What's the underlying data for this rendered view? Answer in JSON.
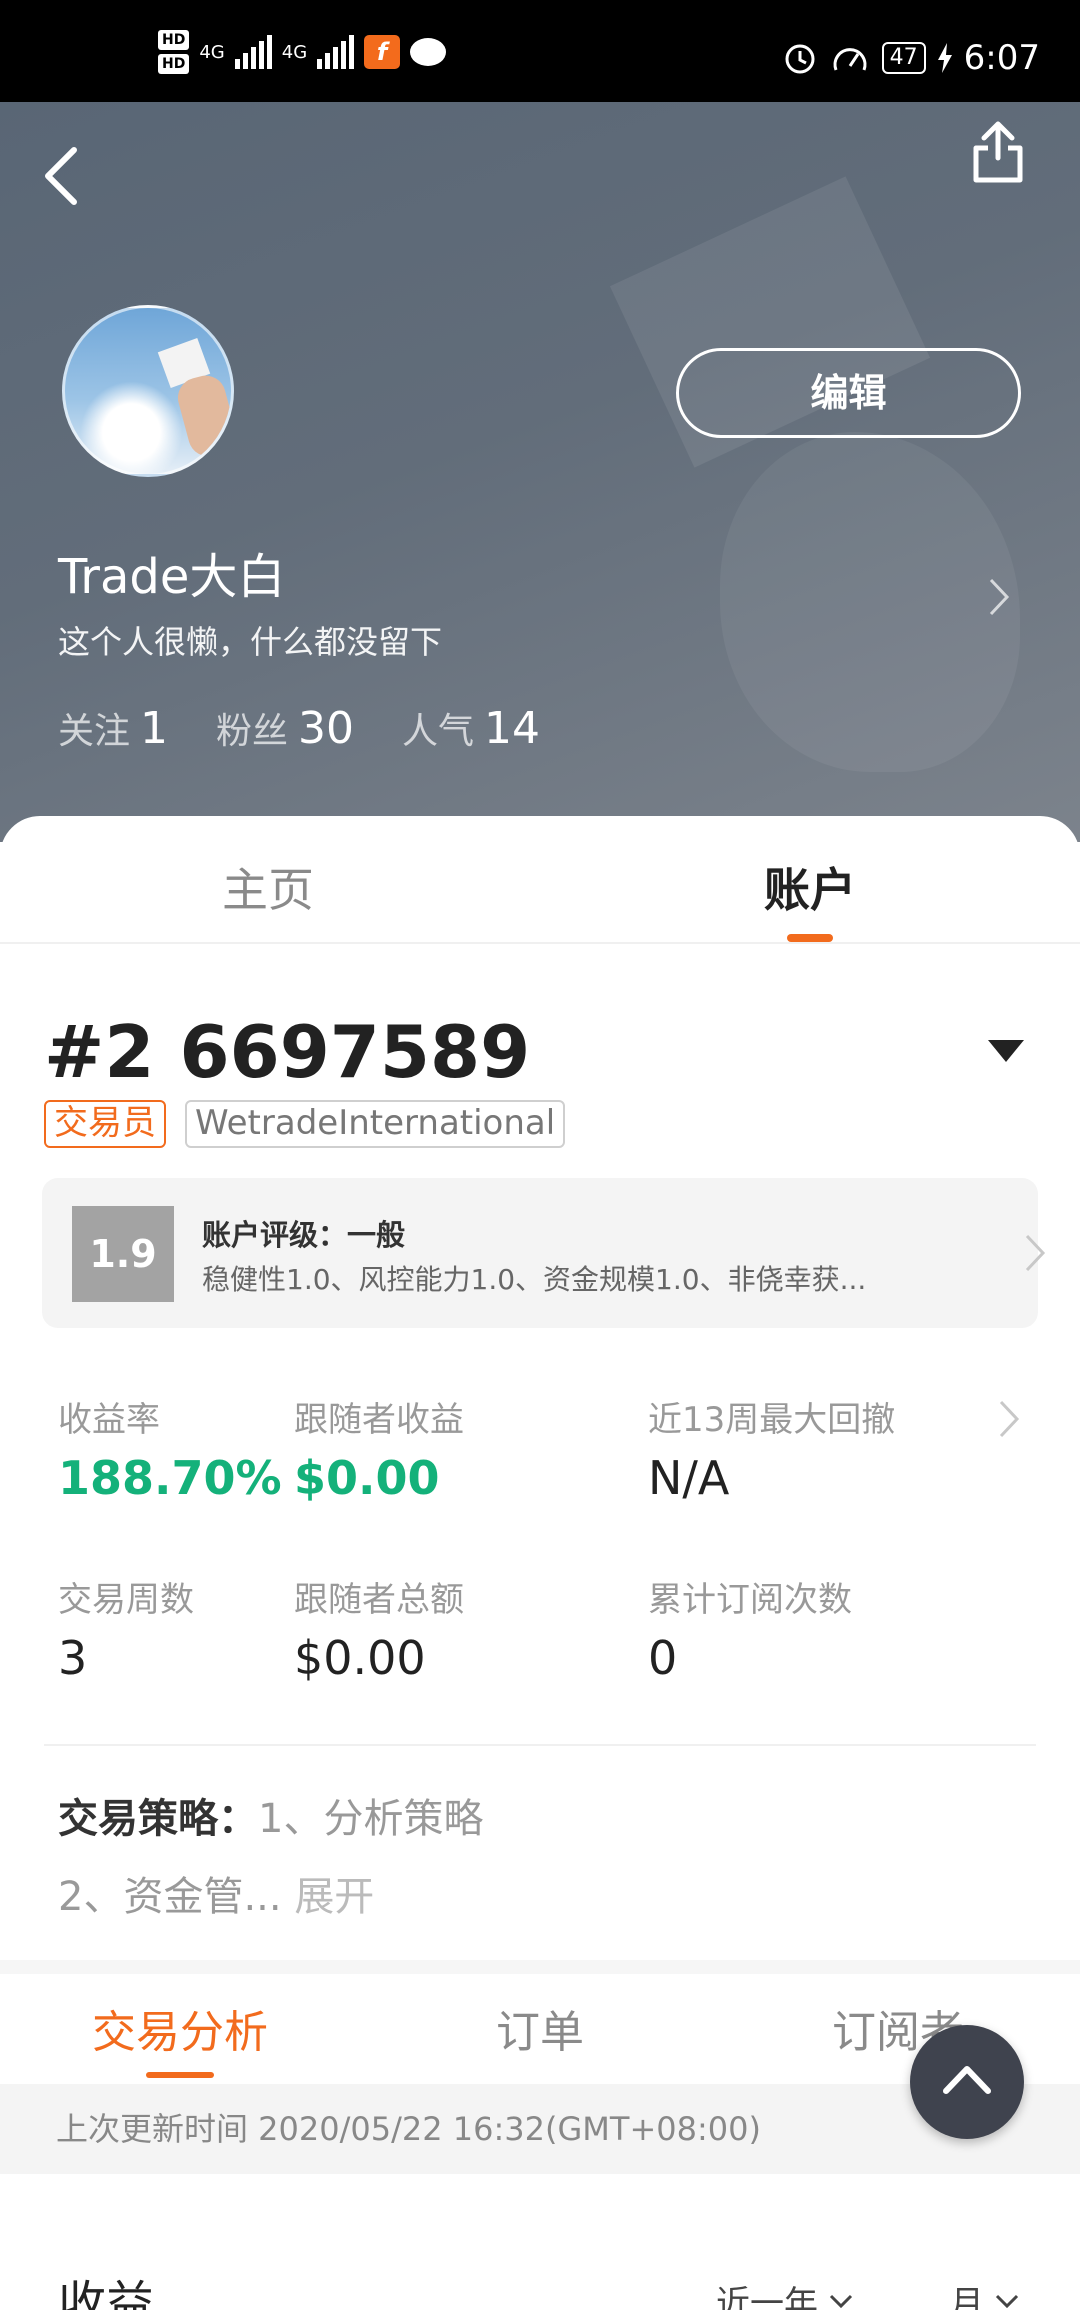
{
  "status_bar": {
    "hd1": "HD",
    "hd2": "HD",
    "net1": "4G",
    "net2": "4G",
    "battery": "47",
    "time": "6:07"
  },
  "header": {
    "edit_label": "编辑",
    "username": "Trade大白",
    "bio": "这个人很懒，什么都没留下",
    "stats": [
      {
        "label": "关注",
        "value": "1"
      },
      {
        "label": "粉丝",
        "value": "30"
      },
      {
        "label": "人气",
        "value": "14"
      }
    ]
  },
  "tabs": {
    "home": "主页",
    "account": "账户",
    "active": "account"
  },
  "account": {
    "number": "#2 6697589",
    "role_badge": "交易员",
    "broker_badge": "WetradeInternational",
    "rating": {
      "score": "1.9",
      "title": "账户评级：一般",
      "detail": "稳健性1.0、风控能力1.0、资金规模1.0、非侥幸获..."
    },
    "metrics": [
      {
        "label": "收益率",
        "value": "188.70%",
        "highlight": true
      },
      {
        "label": "跟随者收益",
        "value": "$0.00",
        "highlight": true
      },
      {
        "label": "近13周最大回撤",
        "value": "N/A",
        "highlight": false
      },
      {
        "label": "交易周数",
        "value": "3",
        "highlight": false
      },
      {
        "label": "跟随者总额",
        "value": "$0.00",
        "highlight": false
      },
      {
        "label": "累计订阅次数",
        "value": "0",
        "highlight": false
      }
    ],
    "strategy": {
      "label": "交易策略：",
      "line1": "1、分析策略",
      "line2": "2、资金管...",
      "expand": "展开"
    }
  },
  "sub_tabs": {
    "analysis": "交易分析",
    "orders": "订单",
    "subscribers": "订阅者",
    "active": "analysis"
  },
  "update_time": "上次更新时间 2020/05/22 16:32(GMT+08:00)",
  "earnings": {
    "title": "收益",
    "range": "近一年",
    "unit": "月"
  },
  "colors": {
    "accent": "#f26b1d",
    "positive": "#14b17a",
    "header_bg": "#5f6b78",
    "fab_bg": "#3f434e"
  },
  "icons": [
    "back-arrow-icon",
    "share-icon",
    "chevron-right-icon",
    "dropdown-triangle-icon",
    "chevron-down-icon",
    "arrow-up-icon"
  ]
}
